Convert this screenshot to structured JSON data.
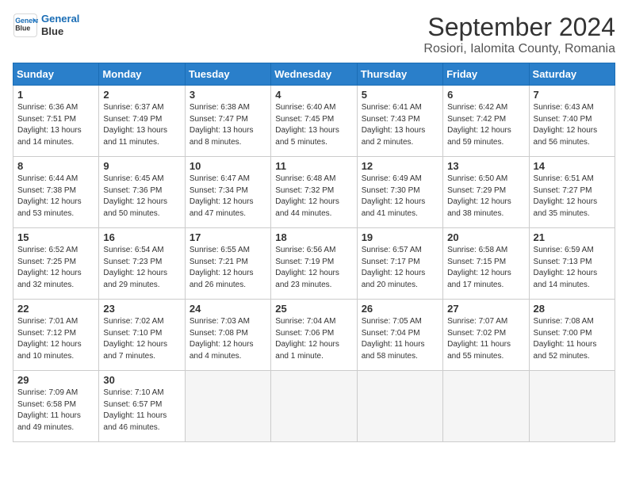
{
  "header": {
    "logo_line1": "General",
    "logo_line2": "Blue",
    "month_title": "September 2024",
    "location": "Rosiori, Ialomita County, Romania"
  },
  "weekdays": [
    "Sunday",
    "Monday",
    "Tuesday",
    "Wednesday",
    "Thursday",
    "Friday",
    "Saturday"
  ],
  "weeks": [
    [
      {
        "day": "1",
        "sunrise": "6:36 AM",
        "sunset": "7:51 PM",
        "daylight": "13 hours and 14 minutes."
      },
      {
        "day": "2",
        "sunrise": "6:37 AM",
        "sunset": "7:49 PM",
        "daylight": "13 hours and 11 minutes."
      },
      {
        "day": "3",
        "sunrise": "6:38 AM",
        "sunset": "7:47 PM",
        "daylight": "13 hours and 8 minutes."
      },
      {
        "day": "4",
        "sunrise": "6:40 AM",
        "sunset": "7:45 PM",
        "daylight": "13 hours and 5 minutes."
      },
      {
        "day": "5",
        "sunrise": "6:41 AM",
        "sunset": "7:43 PM",
        "daylight": "13 hours and 2 minutes."
      },
      {
        "day": "6",
        "sunrise": "6:42 AM",
        "sunset": "7:42 PM",
        "daylight": "12 hours and 59 minutes."
      },
      {
        "day": "7",
        "sunrise": "6:43 AM",
        "sunset": "7:40 PM",
        "daylight": "12 hours and 56 minutes."
      }
    ],
    [
      {
        "day": "8",
        "sunrise": "6:44 AM",
        "sunset": "7:38 PM",
        "daylight": "12 hours and 53 minutes."
      },
      {
        "day": "9",
        "sunrise": "6:45 AM",
        "sunset": "7:36 PM",
        "daylight": "12 hours and 50 minutes."
      },
      {
        "day": "10",
        "sunrise": "6:47 AM",
        "sunset": "7:34 PM",
        "daylight": "12 hours and 47 minutes."
      },
      {
        "day": "11",
        "sunrise": "6:48 AM",
        "sunset": "7:32 PM",
        "daylight": "12 hours and 44 minutes."
      },
      {
        "day": "12",
        "sunrise": "6:49 AM",
        "sunset": "7:30 PM",
        "daylight": "12 hours and 41 minutes."
      },
      {
        "day": "13",
        "sunrise": "6:50 AM",
        "sunset": "7:29 PM",
        "daylight": "12 hours and 38 minutes."
      },
      {
        "day": "14",
        "sunrise": "6:51 AM",
        "sunset": "7:27 PM",
        "daylight": "12 hours and 35 minutes."
      }
    ],
    [
      {
        "day": "15",
        "sunrise": "6:52 AM",
        "sunset": "7:25 PM",
        "daylight": "12 hours and 32 minutes."
      },
      {
        "day": "16",
        "sunrise": "6:54 AM",
        "sunset": "7:23 PM",
        "daylight": "12 hours and 29 minutes."
      },
      {
        "day": "17",
        "sunrise": "6:55 AM",
        "sunset": "7:21 PM",
        "daylight": "12 hours and 26 minutes."
      },
      {
        "day": "18",
        "sunrise": "6:56 AM",
        "sunset": "7:19 PM",
        "daylight": "12 hours and 23 minutes."
      },
      {
        "day": "19",
        "sunrise": "6:57 AM",
        "sunset": "7:17 PM",
        "daylight": "12 hours and 20 minutes."
      },
      {
        "day": "20",
        "sunrise": "6:58 AM",
        "sunset": "7:15 PM",
        "daylight": "12 hours and 17 minutes."
      },
      {
        "day": "21",
        "sunrise": "6:59 AM",
        "sunset": "7:13 PM",
        "daylight": "12 hours and 14 minutes."
      }
    ],
    [
      {
        "day": "22",
        "sunrise": "7:01 AM",
        "sunset": "7:12 PM",
        "daylight": "12 hours and 10 minutes."
      },
      {
        "day": "23",
        "sunrise": "7:02 AM",
        "sunset": "7:10 PM",
        "daylight": "12 hours and 7 minutes."
      },
      {
        "day": "24",
        "sunrise": "7:03 AM",
        "sunset": "7:08 PM",
        "daylight": "12 hours and 4 minutes."
      },
      {
        "day": "25",
        "sunrise": "7:04 AM",
        "sunset": "7:06 PM",
        "daylight": "12 hours and 1 minute."
      },
      {
        "day": "26",
        "sunrise": "7:05 AM",
        "sunset": "7:04 PM",
        "daylight": "11 hours and 58 minutes."
      },
      {
        "day": "27",
        "sunrise": "7:07 AM",
        "sunset": "7:02 PM",
        "daylight": "11 hours and 55 minutes."
      },
      {
        "day": "28",
        "sunrise": "7:08 AM",
        "sunset": "7:00 PM",
        "daylight": "11 hours and 52 minutes."
      }
    ],
    [
      {
        "day": "29",
        "sunrise": "7:09 AM",
        "sunset": "6:58 PM",
        "daylight": "11 hours and 49 minutes."
      },
      {
        "day": "30",
        "sunrise": "7:10 AM",
        "sunset": "6:57 PM",
        "daylight": "11 hours and 46 minutes."
      },
      null,
      null,
      null,
      null,
      null
    ]
  ]
}
